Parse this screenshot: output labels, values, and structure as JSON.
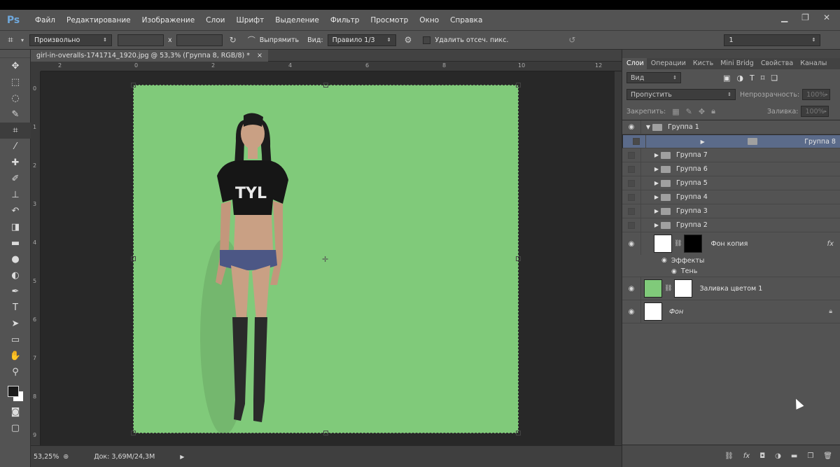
{
  "app": {
    "logo": "Ps"
  },
  "menu": [
    "Файл",
    "Редактирование",
    "Изображение",
    "Слои",
    "Шрифт",
    "Выделение",
    "Фильтр",
    "Просмотр",
    "Окно",
    "Справка"
  ],
  "options": {
    "ratio_select": "Произвольно",
    "x_separator": "x",
    "straighten": "Выпрямить",
    "view_label": "Вид:",
    "view_select": "Правило 1/3",
    "delete_cropped": "Удалить отсеч. пикс.",
    "workspace_select": "1"
  },
  "document": {
    "tab_title": "girl-in-overalls-1741714_1920.jpg @ 53,3% (Группа 8, RGB/8) *",
    "ruler_h": [
      "2",
      "0",
      "2",
      "4",
      "6",
      "8",
      "10",
      "12"
    ],
    "ruler_v": [
      "0",
      "1",
      "2",
      "3",
      "4",
      "5",
      "6",
      "7",
      "8",
      "9"
    ],
    "zoom": "53,25%",
    "doc_size": "Док: 3,69M/24,3M",
    "canvas_color": "#80ca7a"
  },
  "panel": {
    "tabs": [
      "Слои",
      "Операции",
      "Кисть",
      "Mini Bridg",
      "Свойства",
      "Каналы"
    ],
    "kind_select": "Вид",
    "blend_select": "Пропустить",
    "opacity_label": "Непрозрачность:",
    "opacity_value": "100%",
    "lock_label": "Закрепить:",
    "fill_label": "Заливка:",
    "fill_value": "100%",
    "layers": {
      "group1": "Группа 1",
      "groups": [
        "Группа 8",
        "Группа 7",
        "Группа 6",
        "Группа 5",
        "Группа 4",
        "Группа 3",
        "Группа 2"
      ],
      "bg_copy": "Фон копия",
      "effects": "Эффекты",
      "shadow": "Тень",
      "fill": "Заливка цветом 1",
      "bg": "Фон"
    }
  }
}
